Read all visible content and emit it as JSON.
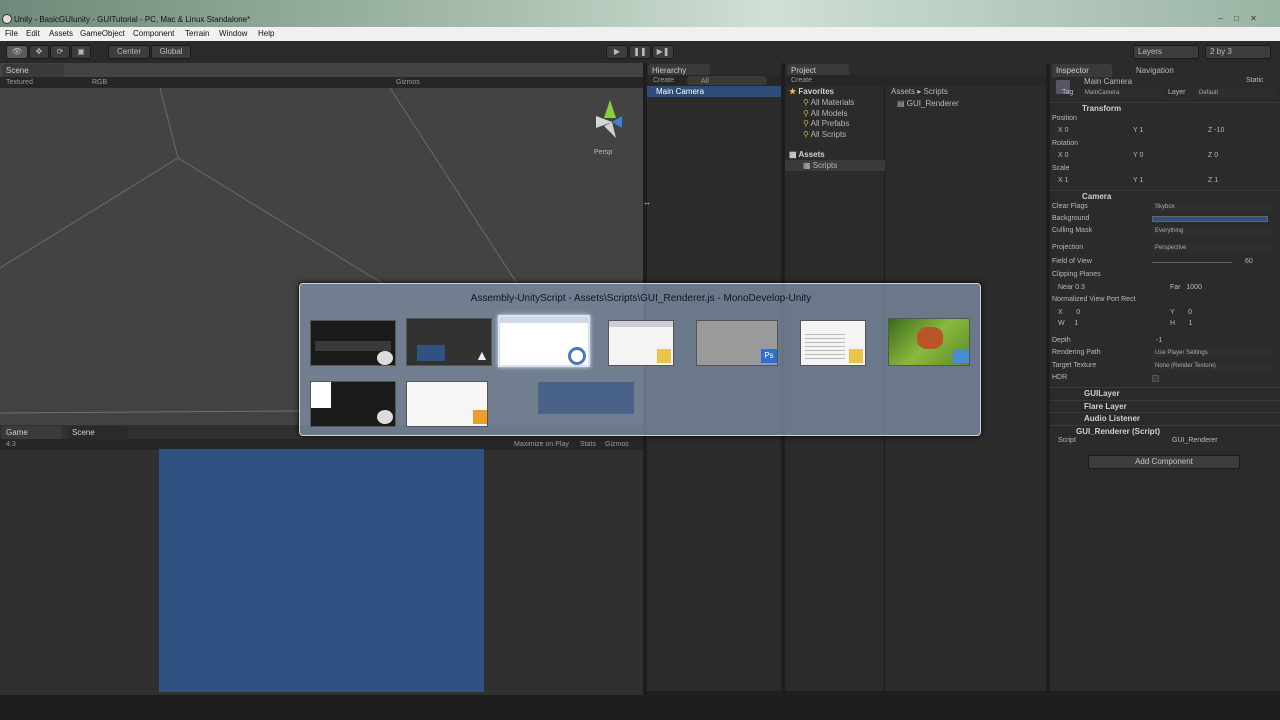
{
  "window": {
    "title": "Unity - BasicGUIunity - GUITutorial - PC, Mac & Linux Standalone*"
  },
  "menu": [
    "File",
    "Edit",
    "Assets",
    "GameObject",
    "Component",
    "Terrain",
    "Window",
    "Help"
  ],
  "toolbar": {
    "center": "Center",
    "global": "Global",
    "layers": "Layers",
    "layout": "2 by 3"
  },
  "scene": {
    "tab": "Scene",
    "shading": "Textured",
    "render_mode": "RGB",
    "gizmos": "Gizmos",
    "persp": "Persp"
  },
  "game": {
    "tab": "Game",
    "scene_tab": "Scene",
    "aspect": "4:3",
    "maximize": "Maximize on Play",
    "stats": "Stats",
    "gizmos": "Gizmos"
  },
  "hierarchy": {
    "tab": "Hierarchy",
    "create": "Create",
    "search": "All",
    "items": [
      "Main Camera"
    ]
  },
  "project": {
    "tab": "Project",
    "create": "Create",
    "favorites": "Favorites",
    "fav_items": [
      "All Materials",
      "All Models",
      "All Prefabs",
      "All Scripts"
    ],
    "assets": "Assets",
    "scripts": "Scripts",
    "breadcrumb_root": "Assets",
    "breadcrumb_child": "Scripts",
    "files": [
      "GUI_Renderer"
    ]
  },
  "inspector": {
    "tab": "Inspector",
    "nav_tab": "Navigation",
    "object_name": "Main Camera",
    "static": "Static",
    "tag_label": "Tag",
    "tag_value": "MainCamera",
    "layer_label": "Layer",
    "layer_value": "Default",
    "transform": {
      "title": "Transform",
      "position": "Position",
      "rotation": "Rotation",
      "scale": "Scale",
      "pos": [
        "0",
        "1",
        "-10"
      ],
      "rot": [
        "0",
        "0",
        "0"
      ],
      "scl": [
        "1",
        "1",
        "1"
      ]
    },
    "camera": {
      "title": "Camera",
      "clear_flags": "Clear Flags",
      "clear_flags_val": "Skybox",
      "background": "Background",
      "culling": "Culling Mask",
      "culling_val": "Everything",
      "projection": "Projection",
      "projection_val": "Perspective",
      "fov": "Field of View",
      "fov_val": "60",
      "clipping": "Clipping Planes",
      "near": "Near",
      "near_val": "0.3",
      "far": "Far",
      "far_val": "1000",
      "viewport": "Normalized View Port Rect",
      "vp_x": "0",
      "vp_y": "0",
      "vp_w": "1",
      "vp_h": "1",
      "depth": "Depth",
      "depth_val": "-1",
      "render_path": "Rendering Path",
      "render_path_val": "Use Player Settings",
      "target_tex": "Target Texture",
      "target_tex_val": "None (Render Texture)",
      "hdr": "HDR"
    },
    "components": [
      "GUILayer",
      "Flare Layer",
      "Audio Listener",
      "GUI_Renderer (Script)"
    ],
    "script_label": "Script",
    "script_val": "GUI_Renderer",
    "add_component": "Add Component"
  },
  "switcher": {
    "title": "Assembly-UnityScript - Assets\\Scripts\\GUI_Renderer.js - MonoDevelop-Unity"
  },
  "colors": {
    "accent": "#2d4d78",
    "game_view": "#2f5283",
    "ps_badge": "#2f6fcf"
  }
}
